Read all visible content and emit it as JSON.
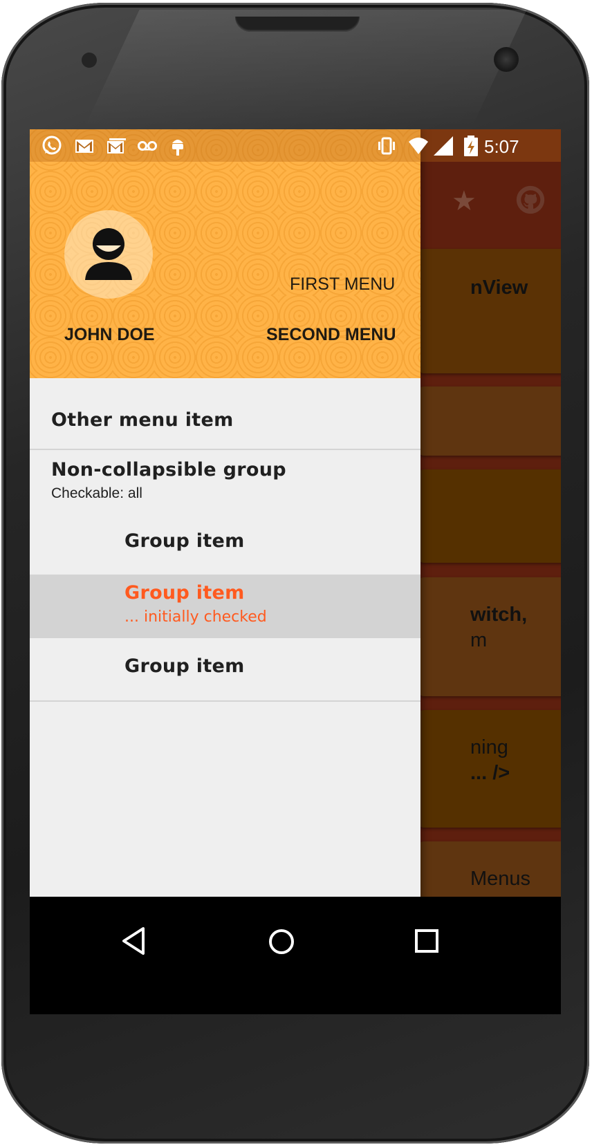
{
  "status_bar": {
    "time": "5:07",
    "icons": [
      "whatsapp-icon",
      "gmail-icon",
      "gmail-stack-icon",
      "voicemail-icon",
      "android-debug-icon",
      "vibrate-icon",
      "wifi-icon",
      "signal-icon",
      "battery-charging-icon"
    ]
  },
  "background_app": {
    "cards": [
      {
        "text": "nView"
      },
      {
        "text": ""
      },
      {
        "text": ""
      },
      {
        "text": "witch,",
        "sub": "m"
      },
      {
        "text": "ning",
        "sub": "... />"
      },
      {
        "text": "Menus"
      }
    ],
    "toolbar_icons": [
      "star-icon",
      "github-icon"
    ]
  },
  "drawer": {
    "header": {
      "name": "JOHN DOE",
      "first_menu": "FIRST MENU",
      "second_menu": "SECOND MENU",
      "accent_color": "#ffb347"
    },
    "items": {
      "other": "Other menu item",
      "group_title": "Non-collapsible group",
      "group_subtitle": "Checkable: all",
      "group_item_1": "Group item",
      "group_item_2": "Group item",
      "group_item_2_sub": "... initially checked",
      "group_item_3": "Group item"
    },
    "checked_color": "#ff5a1f"
  },
  "nav_bar": {
    "back": "back-icon",
    "home": "home-icon",
    "recents": "recents-icon"
  }
}
